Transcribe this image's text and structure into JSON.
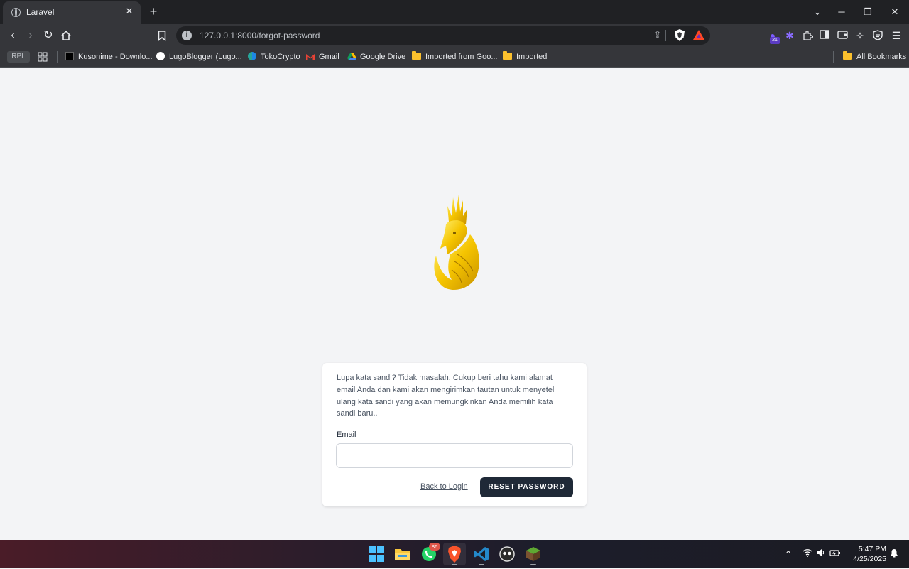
{
  "browser": {
    "tab_title": "Laravel",
    "url": "127.0.0.1:8000/forgot-password",
    "extension_badge": "21",
    "bookmarks": [
      {
        "label": "RPL"
      },
      {
        "label": "Kusonime - Downlo..."
      },
      {
        "label": "LugoBlogger (Lugo..."
      },
      {
        "label": "TokoCrypto"
      },
      {
        "label": "Gmail"
      },
      {
        "label": "Google Drive"
      },
      {
        "label": "Imported from Goo..."
      },
      {
        "label": "Imported"
      }
    ],
    "all_bookmarks": "All Bookmarks"
  },
  "page": {
    "description": "Lupa kata sandi? Tidak masalah. Cukup beri tahu kami alamat email Anda dan kami akan mengirimkan tautan untuk menyetel ulang kata sandi yang akan memungkinkan Anda memilih kata sandi baru..",
    "email_label": "Email",
    "email_value": "",
    "back_link": "Back to Login",
    "reset_button": "RESET PASSWORD",
    "logo_color": "#f5c400",
    "button_color": "#1f2937"
  },
  "taskbar": {
    "whatsapp_badge": "86",
    "time": "5:47 PM",
    "date": "4/25/2025"
  }
}
